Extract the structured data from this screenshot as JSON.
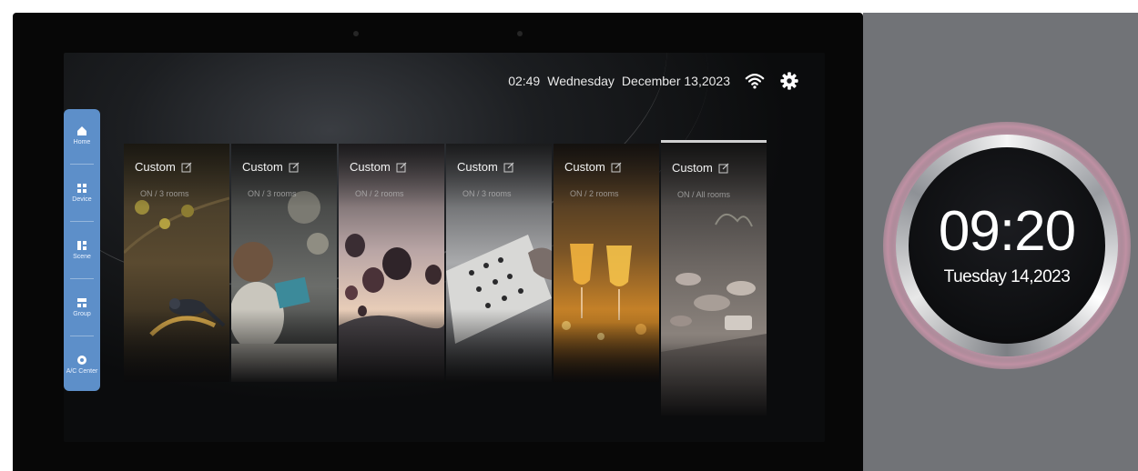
{
  "status": {
    "time": "02:49",
    "day": "Wednesday",
    "date": "December 13,2023",
    "wifi_icon": "wifi-icon",
    "settings_icon": "gear-icon"
  },
  "sidebar": {
    "color": "#5d8fc9",
    "items": [
      {
        "label": "Home",
        "icon": "home-icon"
      },
      {
        "label": "Device",
        "icon": "device-icon"
      },
      {
        "label": "Scene",
        "icon": "scene-icon"
      },
      {
        "label": "Group",
        "icon": "group-icon"
      },
      {
        "label": "A/C Center",
        "icon": "ac-icon"
      }
    ]
  },
  "cards": [
    {
      "title": "Custom",
      "subtitle": "ON / 3 rooms",
      "photo": "bird on branch"
    },
    {
      "title": "Custom",
      "subtitle": "ON / 3 rooms",
      "photo": "child with puzzle"
    },
    {
      "title": "Custom",
      "subtitle": "ON / 2 rooms",
      "photo": "hot air balloons"
    },
    {
      "title": "Custom",
      "subtitle": "ON / 3 rooms",
      "photo": "go board"
    },
    {
      "title": "Custom",
      "subtitle": "ON / 2 rooms",
      "photo": "wine glasses"
    },
    {
      "title": "Custom",
      "subtitle": "ON / All rooms",
      "photo": "table setting"
    }
  ],
  "knob": {
    "time": "09:20",
    "date": "Tuesday 14,2023"
  }
}
